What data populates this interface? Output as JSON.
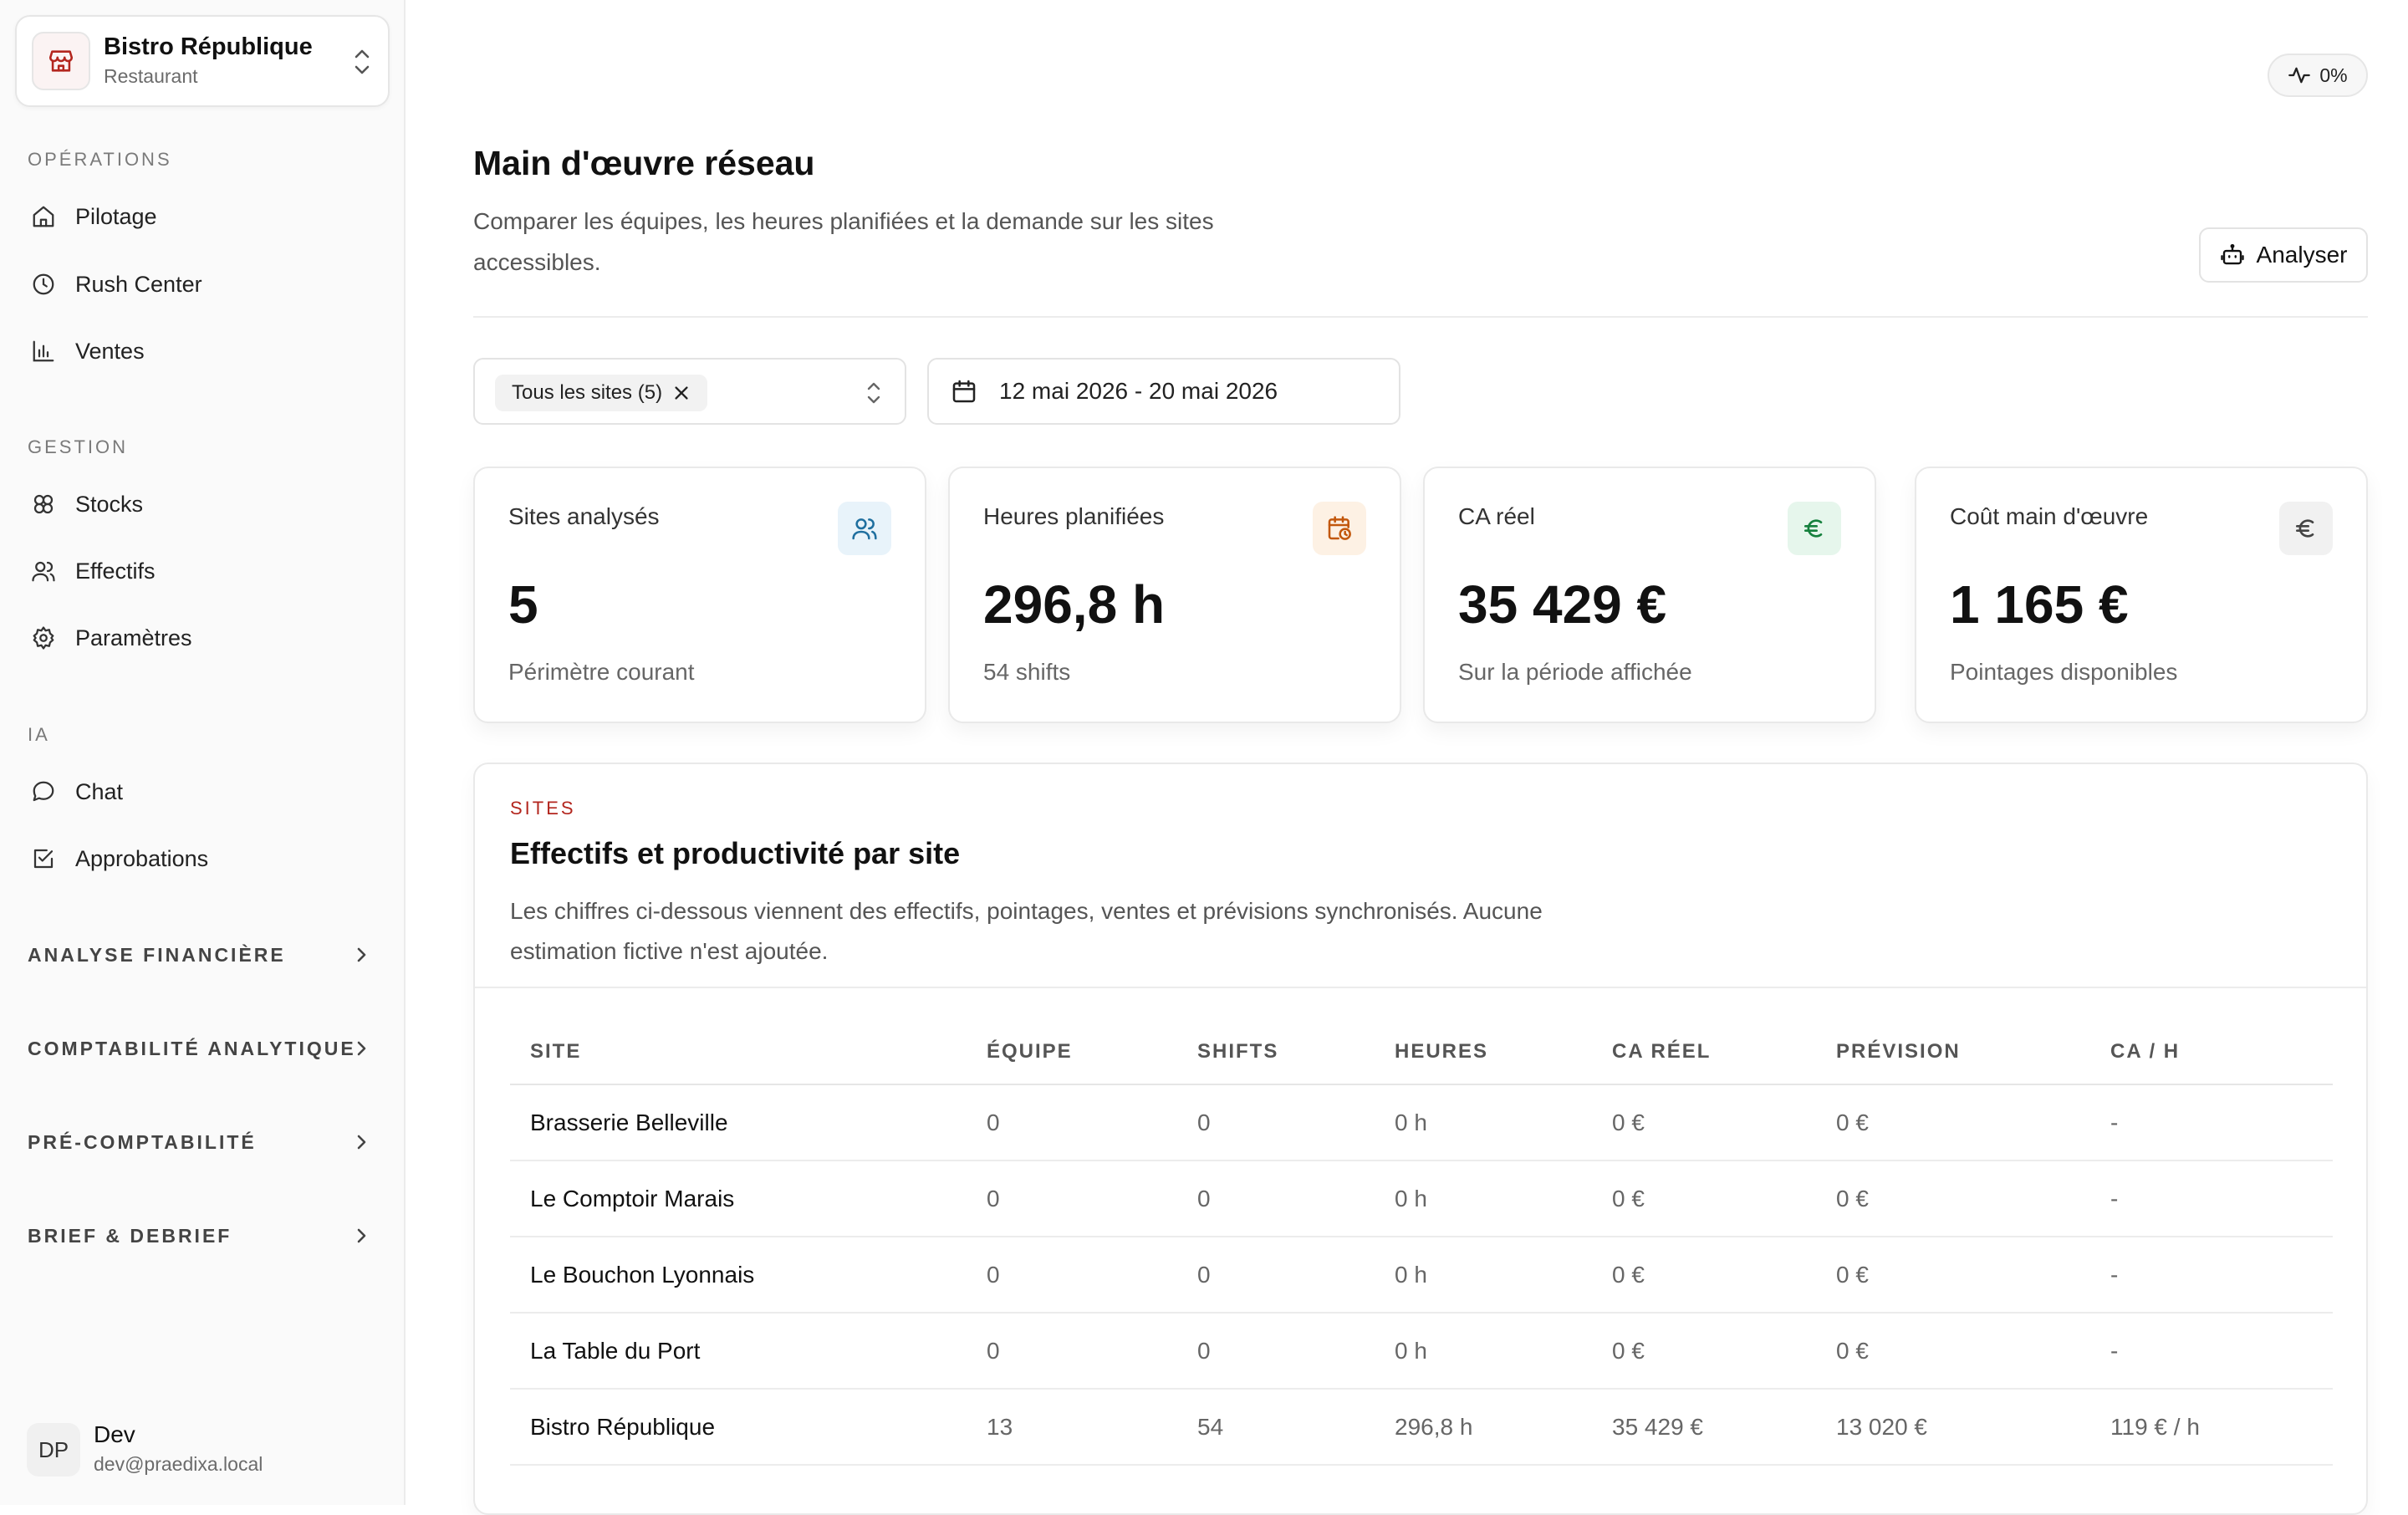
{
  "org": {
    "name": "Bistro République",
    "type": "Restaurant"
  },
  "sidebar": {
    "sections": [
      {
        "label": "OPÉRATIONS",
        "items": [
          {
            "label": "Pilotage",
            "icon": "home-icon"
          },
          {
            "label": "Rush Center",
            "icon": "clock-icon"
          },
          {
            "label": "Ventes",
            "icon": "bar-chart-icon"
          }
        ]
      },
      {
        "label": "GESTION",
        "items": [
          {
            "label": "Stocks",
            "icon": "boxes-icon"
          },
          {
            "label": "Effectifs",
            "icon": "users-icon"
          },
          {
            "label": "Paramètres",
            "icon": "gear-icon"
          }
        ]
      },
      {
        "label": "IA",
        "items": [
          {
            "label": "Chat",
            "icon": "chat-icon"
          },
          {
            "label": "Approbations",
            "icon": "checkbox-icon"
          }
        ]
      }
    ],
    "groups": [
      {
        "label": "ANALYSE FINANCIÈRE"
      },
      {
        "label": "COMPTABILITÉ ANALYTIQUE"
      },
      {
        "label": "PRÉ-COMPTABILITÉ"
      },
      {
        "label": "BRIEF & DEBRIEF"
      }
    ],
    "user": {
      "initials": "DP",
      "name": "Dev",
      "email": "dev@praedixa.local"
    }
  },
  "header": {
    "pulse_label": "0%",
    "title": "Main d'œuvre réseau",
    "subtitle": "Comparer les équipes, les heures planifiées et la demande sur les sites accessibles.",
    "analyse_label": "Analyser"
  },
  "filters": {
    "sites_chip": "Tous les sites (5)",
    "date_range": "12 mai 2026 - 20 mai 2026"
  },
  "kpis": [
    {
      "label": "Sites analysés",
      "value": "5",
      "sub": "Périmètre courant",
      "icon": "users-icon",
      "accent": "#1f6f9f",
      "accent_bg": "#e8f3fa"
    },
    {
      "label": "Heures planifiées",
      "value": "296,8 h",
      "sub": "54 shifts",
      "icon": "calendar-clock-icon",
      "accent": "#c2570c",
      "accent_bg": "#fdf1e4"
    },
    {
      "label": "CA réel",
      "value": "35 429 €",
      "sub": "Sur la période affichée",
      "icon": "euro-icon",
      "accent": "#15803d",
      "accent_bg": "#e6f6ec"
    },
    {
      "label": "Coût main d'œuvre",
      "value": "1 165 €",
      "sub": "Pointages disponibles",
      "icon": "euro-icon",
      "accent": "#444444",
      "accent_bg": "#f1f1f1"
    }
  ],
  "sites_panel": {
    "eyebrow": "SITES",
    "title": "Effectifs et productivité par site",
    "description": "Les chiffres ci-dessous viennent des effectifs, pointages, ventes et prévisions synchronisés. Aucune estimation fictive n'est ajoutée.",
    "columns": [
      "SITE",
      "ÉQUIPE",
      "SHIFTS",
      "HEURES",
      "CA RÉEL",
      "PRÉVISION",
      "CA / H"
    ],
    "rows": [
      [
        "Brasserie Belleville",
        "0",
        "0",
        "0 h",
        "0 €",
        "0 €",
        "-"
      ],
      [
        "Le Comptoir Marais",
        "0",
        "0",
        "0 h",
        "0 €",
        "0 €",
        "-"
      ],
      [
        "Le Bouchon Lyonnais",
        "0",
        "0",
        "0 h",
        "0 €",
        "0 €",
        "-"
      ],
      [
        "La Table du Port",
        "0",
        "0",
        "0 h",
        "0 €",
        "0 €",
        "-"
      ],
      [
        "Bistro République",
        "13",
        "54",
        "296,8 h",
        "35 429 €",
        "13 020 €",
        "119 € / h"
      ]
    ]
  }
}
